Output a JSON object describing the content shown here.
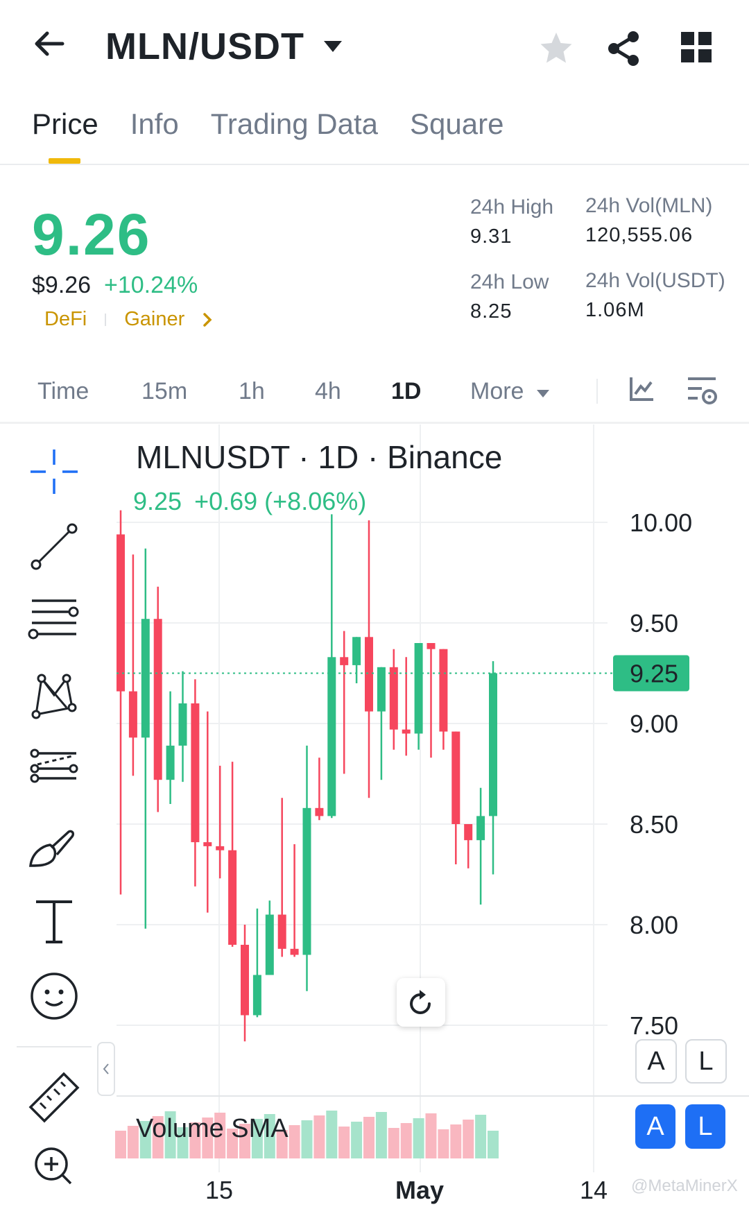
{
  "header": {
    "pair": "MLN/USDT",
    "icons": [
      "back-arrow-icon",
      "caret-down-icon",
      "star-icon",
      "share-icon",
      "grid-icon"
    ]
  },
  "tabs": [
    {
      "label": "Price",
      "active": true
    },
    {
      "label": "Info",
      "active": false
    },
    {
      "label": "Trading Data",
      "active": false
    },
    {
      "label": "Square",
      "active": false
    }
  ],
  "ticker": {
    "last_price": "9.26",
    "usd_price": "$9.26",
    "change_pct": "+10.24%",
    "tags": [
      "DeFi",
      "Gainer"
    ],
    "stats": {
      "high_label": "24h High",
      "high": "9.31",
      "low_label": "24h Low",
      "low": "8.25",
      "vol_base_label": "24h Vol(MLN)",
      "vol_base": "120,555.06",
      "vol_quote_label": "24h Vol(USDT)",
      "vol_quote": "1.06M"
    }
  },
  "intervals": [
    {
      "label": "Time",
      "active": false
    },
    {
      "label": "15m",
      "active": false
    },
    {
      "label": "1h",
      "active": false
    },
    {
      "label": "4h",
      "active": false
    },
    {
      "label": "1D",
      "active": true
    },
    {
      "label": "More",
      "active": false
    }
  ],
  "chart_header": {
    "title": "MLNUSDT · 1D · Binance",
    "last_value": "9.25",
    "change": "+0.69 (+8.06%)"
  },
  "volume_label": "Volume SMA",
  "scale_buttons": [
    "A",
    "L"
  ],
  "watermark": "@MetaMinerX",
  "colors": {
    "up": "#2ebd85",
    "down": "#f6465d",
    "accent": "#f0b90b",
    "blue": "#1e6ff5"
  },
  "chart_data": {
    "type": "candlestick",
    "ylim": [
      7.4,
      10.4
    ],
    "y_ticks": [
      "10.00",
      "9.50",
      "9.00",
      "8.50",
      "8.00",
      "7.50"
    ],
    "x_ticks": [
      "15",
      "May",
      "14"
    ],
    "current_price": "9.25",
    "candles": [
      {
        "o": 9.94,
        "h": 10.06,
        "l": 8.15,
        "c": 9.16
      },
      {
        "o": 9.16,
        "h": 9.84,
        "l": 8.74,
        "c": 8.93
      },
      {
        "o": 8.93,
        "h": 9.87,
        "l": 7.98,
        "c": 9.52
      },
      {
        "o": 9.52,
        "h": 9.68,
        "l": 8.56,
        "c": 8.72
      },
      {
        "o": 8.72,
        "h": 9.16,
        "l": 8.6,
        "c": 8.89
      },
      {
        "o": 8.89,
        "h": 9.26,
        "l": 8.71,
        "c": 9.1
      },
      {
        "o": 9.1,
        "h": 9.22,
        "l": 8.19,
        "c": 8.41
      },
      {
        "o": 8.41,
        "h": 9.06,
        "l": 8.06,
        "c": 8.39
      },
      {
        "o": 8.39,
        "h": 8.79,
        "l": 8.23,
        "c": 8.37
      },
      {
        "o": 8.37,
        "h": 8.81,
        "l": 7.89,
        "c": 7.9
      },
      {
        "o": 7.9,
        "h": 8.0,
        "l": 7.42,
        "c": 7.55
      },
      {
        "o": 7.55,
        "h": 8.08,
        "l": 7.54,
        "c": 7.75
      },
      {
        "o": 7.75,
        "h": 8.12,
        "l": 7.86,
        "c": 8.05
      },
      {
        "o": 8.05,
        "h": 8.63,
        "l": 7.84,
        "c": 7.88
      },
      {
        "o": 7.88,
        "h": 8.4,
        "l": 7.84,
        "c": 7.85
      },
      {
        "o": 7.85,
        "h": 8.89,
        "l": 7.67,
        "c": 8.58
      },
      {
        "o": 8.58,
        "h": 8.83,
        "l": 8.52,
        "c": 8.54
      },
      {
        "o": 8.54,
        "h": 10.04,
        "l": 8.53,
        "c": 9.33
      },
      {
        "o": 9.33,
        "h": 9.46,
        "l": 8.75,
        "c": 9.29
      },
      {
        "o": 9.29,
        "h": 9.4,
        "l": 9.2,
        "c": 9.43
      },
      {
        "o": 9.43,
        "h": 10.01,
        "l": 8.63,
        "c": 9.06
      },
      {
        "o": 9.06,
        "h": 9.26,
        "l": 8.72,
        "c": 9.28
      },
      {
        "o": 9.28,
        "h": 9.37,
        "l": 8.87,
        "c": 8.97
      },
      {
        "o": 8.97,
        "h": 9.33,
        "l": 8.84,
        "c": 8.95
      },
      {
        "o": 8.95,
        "h": 9.31,
        "l": 8.87,
        "c": 9.4
      },
      {
        "o": 9.4,
        "h": 9.33,
        "l": 8.83,
        "c": 9.37
      },
      {
        "o": 9.37,
        "h": 9.35,
        "l": 8.87,
        "c": 8.96
      },
      {
        "o": 8.96,
        "h": 8.6,
        "l": 8.3,
        "c": 8.5
      },
      {
        "o": 8.5,
        "h": 8.4,
        "l": 8.28,
        "c": 8.42
      },
      {
        "o": 8.42,
        "h": 8.68,
        "l": 8.1,
        "c": 8.54
      },
      {
        "o": 8.54,
        "h": 9.31,
        "l": 8.25,
        "c": 9.25
      }
    ]
  }
}
